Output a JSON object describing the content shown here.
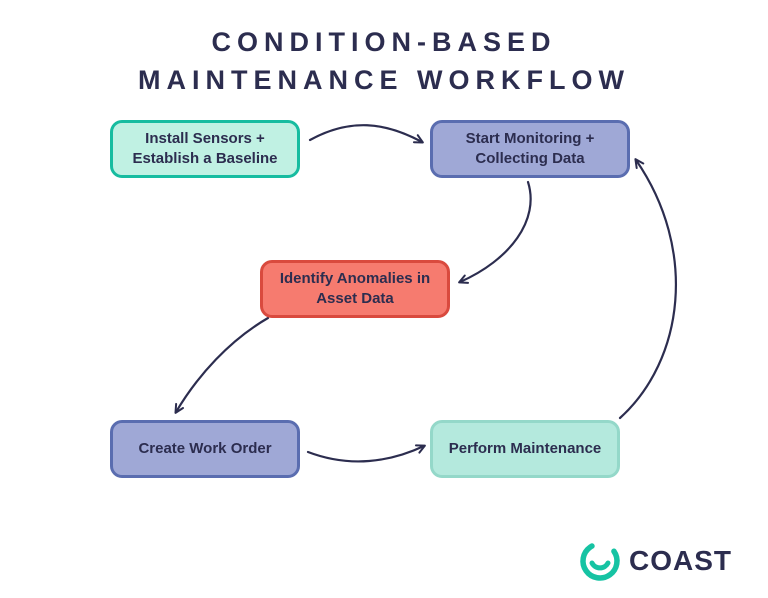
{
  "title_line1": "CONDITION-BASED",
  "title_line2": "MAINTENANCE WORKFLOW",
  "nodes": {
    "install": "Install Sensors + Establish a Baseline",
    "monitor": "Start Monitoring + Collecting Data",
    "anomalies": "Identify Anomalies in Asset Data",
    "workorder": "Create Work Order",
    "perform": "Perform Maintenance"
  },
  "brand": {
    "name": "COAST",
    "color_accent": "#16c3a3",
    "color_dark": "#2c2d4f"
  },
  "diagram_flow": [
    {
      "from": "install",
      "to": "monitor"
    },
    {
      "from": "monitor",
      "to": "anomalies"
    },
    {
      "from": "anomalies",
      "to": "workorder"
    },
    {
      "from": "workorder",
      "to": "perform"
    },
    {
      "from": "perform",
      "to": "monitor"
    }
  ],
  "colors": {
    "teal_fill": "#c0f1e3",
    "teal_border": "#17bca0",
    "blue_fill": "#9fa8d6",
    "blue_border": "#5a6db0",
    "red_fill": "#f67b6f",
    "red_border": "#d94a3e",
    "mint_fill": "#b4e9dd",
    "mint_border": "#94d8c9",
    "arrow": "#2c2d4f"
  }
}
